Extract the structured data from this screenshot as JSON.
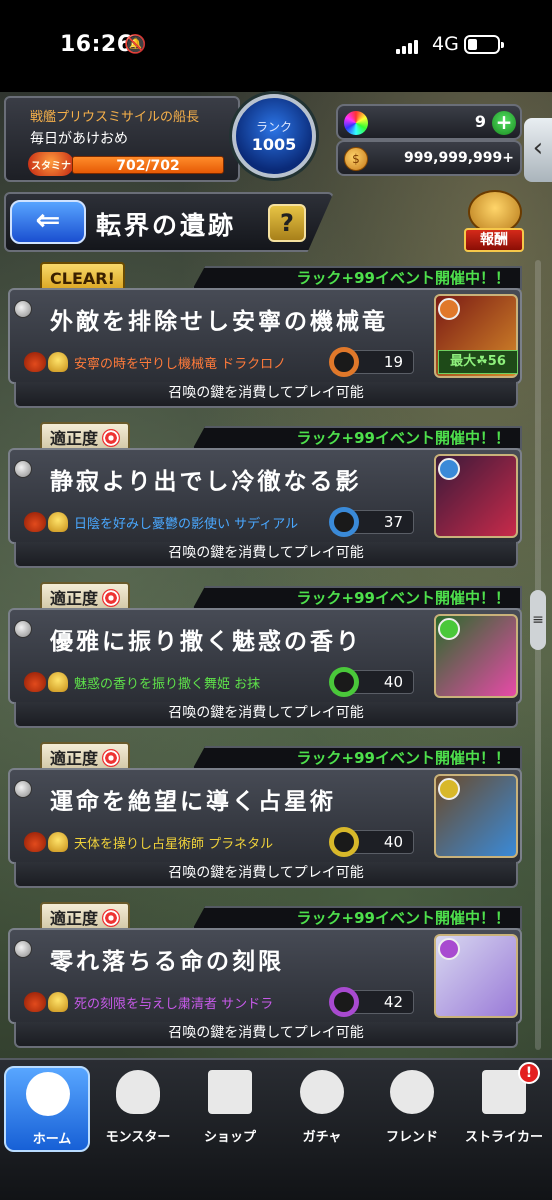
{
  "status_bar": {
    "time": "16:26",
    "network": "4G"
  },
  "player": {
    "ship_name": "戦艦プリウスミサイルの船長",
    "name": "毎日があけおめ",
    "stamina_label": "スタミナ",
    "stamina": "702/702",
    "rank_label": "ランク",
    "rank": "1005",
    "orbs": "9",
    "gold": "999,999,999+"
  },
  "header": {
    "back_symbol": "⇐",
    "title": "転界の遺跡",
    "help": "?",
    "reward_label": "報酬"
  },
  "quests": [
    {
      "tag": "CLEAR!",
      "event": "ラック+99イベント開催中！！",
      "title": "外敵を排除せし安寧の機械竜",
      "boss": "安寧の時を守りし機械竜 ドラクロノ",
      "boss_color": "#ff7a3a",
      "keys": "19",
      "key_color": "#e0782a",
      "max_luck": "最大☘56",
      "footer": "召喚の鍵を消費してプレイ可能",
      "portrait_colors": [
        "#7a1a14",
        "#d68a2a"
      ]
    },
    {
      "tag": "適正度",
      "event": "ラック+99イベント開催中！！",
      "title": "静寂より出でし冷徹なる影",
      "boss": "日陰を好みし憂鬱の影使い サディアル",
      "boss_color": "#4aa8ff",
      "keys": "37",
      "key_color": "#3a8ad8",
      "footer": "召喚の鍵を消費してプレイ可能",
      "portrait_colors": [
        "#3a1a3a",
        "#c82a4a"
      ]
    },
    {
      "tag": "適正度",
      "event": "ラック+99イベント開催中！！",
      "title": "優雅に振り撒く魅惑の香り",
      "boss": "魅惑の香りを振り撒く舞姫 お抹",
      "boss_color": "#5ee04a",
      "keys": "40",
      "key_color": "#4ac83a",
      "footer": "召喚の鍵を消費してプレイ可能",
      "portrait_colors": [
        "#2a6a2a",
        "#e84aa8"
      ]
    },
    {
      "tag": "適正度",
      "event": "ラック+99イベント開催中！！",
      "title": "運命を絶望に導く占星術",
      "boss": "天体を操りし占星術師 プラネタル",
      "boss_color": "#f0d23a",
      "keys": "40",
      "key_color": "#d8b82a",
      "footer": "召喚の鍵を消費してプレイ可能",
      "portrait_colors": [
        "#6a4a2a",
        "#3a8ad8"
      ]
    },
    {
      "tag": "適正度",
      "event": "ラック+99イベント開催中！！",
      "title": "零れ落ちる命の刻限",
      "boss": "死の刻限を与えし粛清者 サンドラ",
      "boss_color": "#c65ae8",
      "keys": "42",
      "key_color": "#a84ad0",
      "footer": "召喚の鍵を消費してプレイ可能",
      "portrait_colors": [
        "#d8d8f0",
        "#9a7ad8"
      ]
    }
  ],
  "nav": {
    "items": [
      {
        "label": "ホーム",
        "icon": "home-icon"
      },
      {
        "label": "モンスター",
        "icon": "monster-icon"
      },
      {
        "label": "ショップ",
        "icon": "cart-icon"
      },
      {
        "label": "ガチャ",
        "icon": "egg-icon"
      },
      {
        "label": "フレンド",
        "icon": "friends-icon"
      },
      {
        "label": "ストライカー",
        "icon": "striker-card-icon"
      }
    ],
    "badge": "!"
  }
}
